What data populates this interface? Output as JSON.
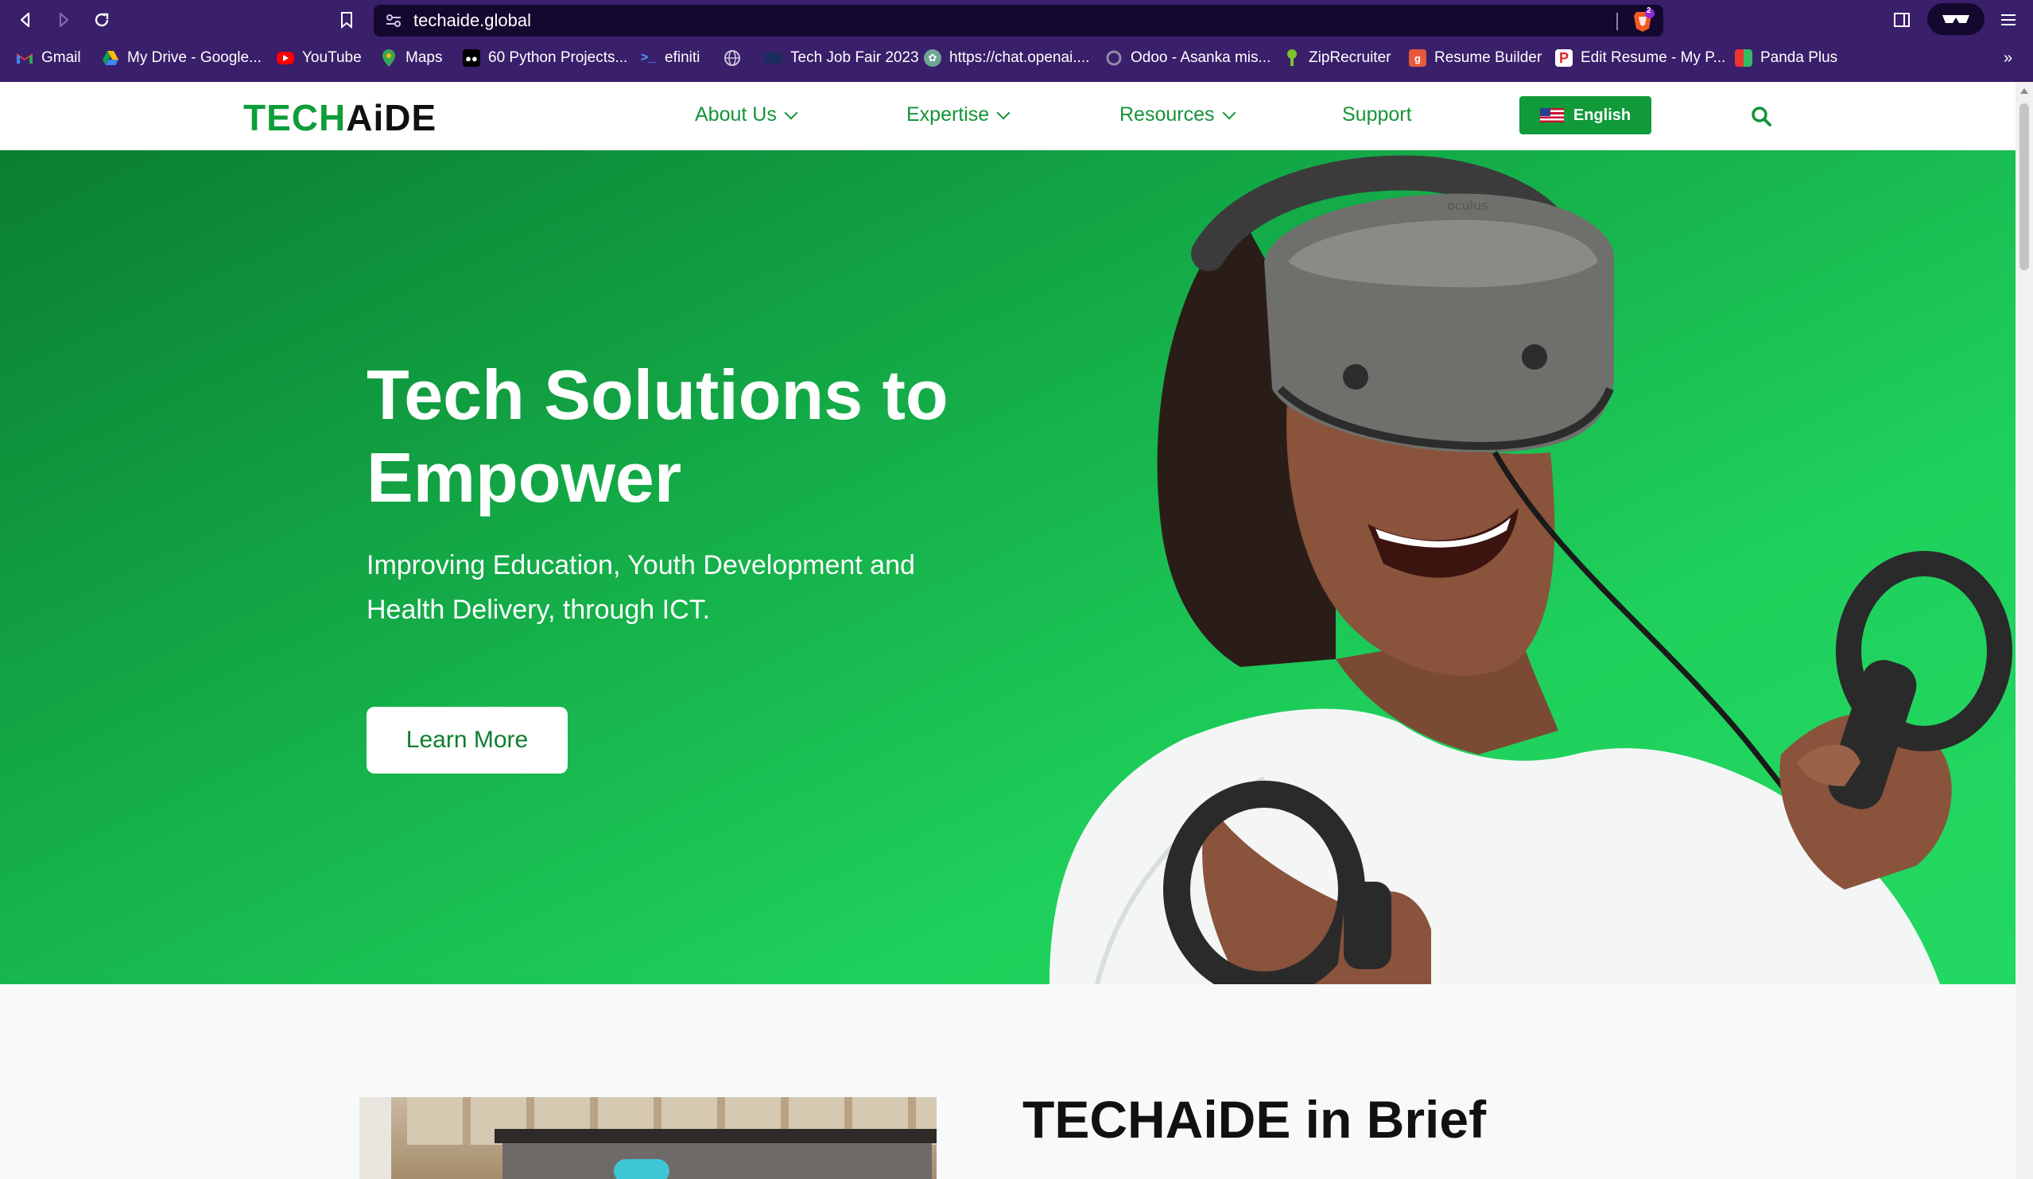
{
  "browser": {
    "url": "techaide.global",
    "bookmarks": [
      {
        "label": "Gmail",
        "icon": "gmail-icon"
      },
      {
        "label": "My Drive - Google...",
        "icon": "drive-icon"
      },
      {
        "label": "YouTube",
        "icon": "youtube-icon"
      },
      {
        "label": "Maps",
        "icon": "maps-icon"
      },
      {
        "label": "60 Python Projects...",
        "icon": "medium-icon"
      },
      {
        "label": "efiniti",
        "icon": "terminal-icon"
      },
      {
        "label": "",
        "icon": "globe-icon"
      },
      {
        "label": "Tech Job Fair 2023",
        "icon": "event-icon"
      },
      {
        "label": "https://chat.openai....",
        "icon": "openai-icon"
      },
      {
        "label": "Odoo - Asanka mis...",
        "icon": "odoo-icon"
      },
      {
        "label": "ZipRecruiter",
        "icon": "ziprecruiter-icon"
      },
      {
        "label": "Resume Builder",
        "icon": "resume-builder-icon"
      },
      {
        "label": "Edit Resume - My P...",
        "icon": "edit-resume-icon"
      },
      {
        "label": "Panda Plus",
        "icon": "panda-icon"
      }
    ],
    "overflow_label": "»",
    "shield_count": "2"
  },
  "site": {
    "logo_part1": "TECH",
    "logo_part2": "AiDE",
    "nav": [
      {
        "label": "About Us",
        "has_dropdown": true
      },
      {
        "label": "Expertise",
        "has_dropdown": true
      },
      {
        "label": "Resources",
        "has_dropdown": true
      },
      {
        "label": "Support",
        "has_dropdown": false
      }
    ],
    "language": "English"
  },
  "hero": {
    "title": "Tech Solutions to Empower",
    "subtitle": "Improving Education, Youth Development and Health Delivery, through ICT.",
    "cta": "Learn More",
    "headset_brand": "oculus"
  },
  "brief": {
    "title": "TECHAiDE in Brief"
  },
  "colors": {
    "browser_chrome": "#3a1f6b",
    "brand_green": "#109a3a",
    "hero_green": "#1fd15c"
  }
}
